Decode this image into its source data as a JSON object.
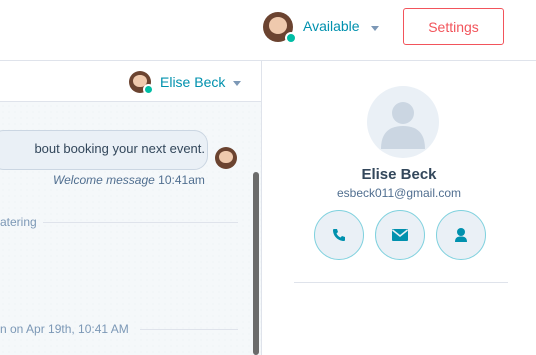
{
  "topbar": {
    "availability_label": "Available",
    "settings_label": "Settings"
  },
  "chat": {
    "header_contact_name": "Elise Beck",
    "message_text": "bout booking your next event.",
    "message_label": "Welcome message",
    "message_time": "10:41am",
    "divider_1": "atering",
    "divider_2": "n on Apr 19th, 10:41 AM"
  },
  "contact": {
    "name": "Elise Beck",
    "email": "esbeck011@gmail.com"
  },
  "colors": {
    "accent": "#0091ae",
    "settings": "#f2545b",
    "status_online": "#00bda5"
  },
  "icons": {
    "call": "phone-icon",
    "email": "envelope-icon",
    "profile": "person-icon"
  }
}
